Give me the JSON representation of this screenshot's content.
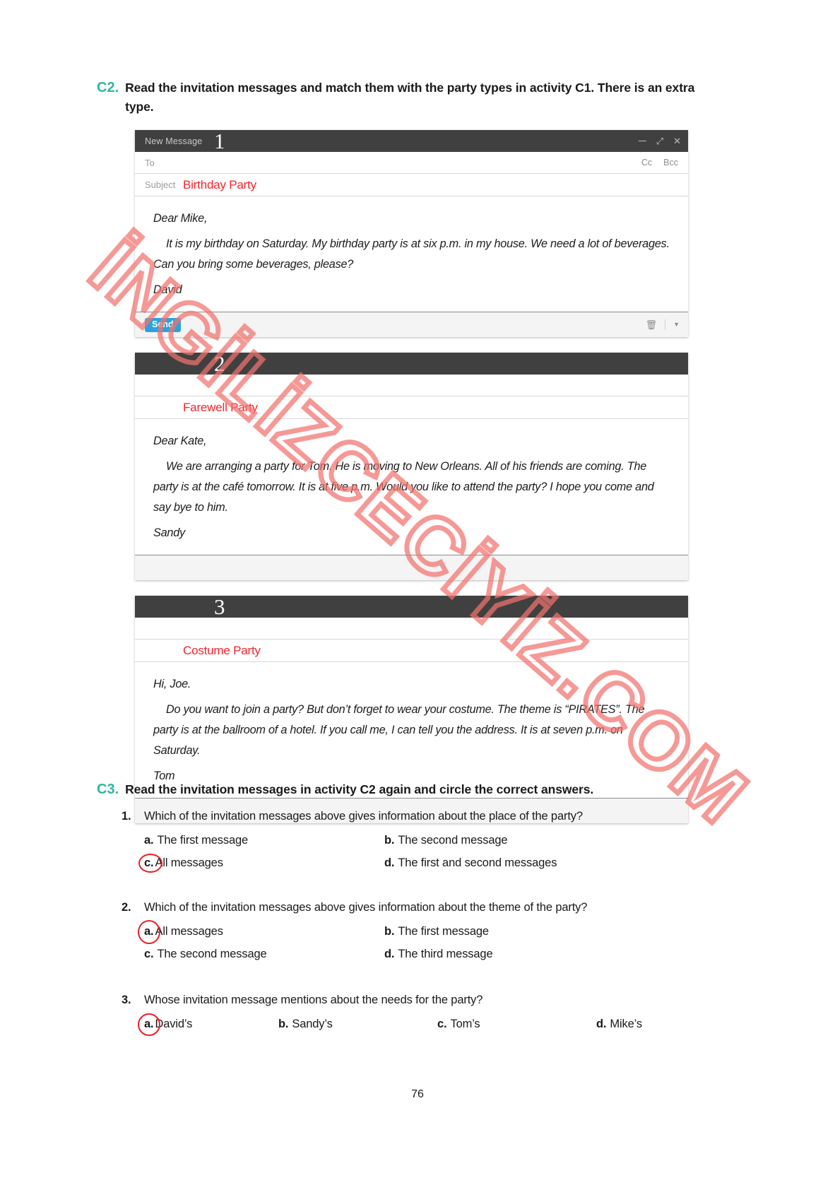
{
  "activities": {
    "c2": {
      "code": "C2.",
      "instruction": "Read the invitation messages and match them with the party types in activity C1. There is an extra type."
    },
    "c3": {
      "code": "C3.",
      "instruction": "Read the invitation messages in activity C2 again and circle the correct answers."
    }
  },
  "messages": [
    {
      "number": "1",
      "window_title": "New Message",
      "to_label": "To",
      "to_value": "",
      "cc_label": "Cc",
      "bcc_label": "Bcc",
      "subject_label": "Subject",
      "subject_value": "Birthday Party",
      "greeting": "Dear Mike,",
      "body": "It is my birthday on Saturday. My birthday party is at six p.m. in my house. We need a lot of beverages. Can you bring some beverages, please?",
      "signature": "David",
      "send_label": "Send",
      "trash_icon": "trash-icon",
      "caret_icon": "caret-down-icon"
    },
    {
      "number": "2",
      "window_title": "",
      "to_label": "",
      "to_value": "",
      "cc_label": "",
      "bcc_label": "",
      "subject_label": "",
      "subject_value": "Farewell Party",
      "greeting": "Dear Kate,",
      "body": "We are arranging a party for Tom. He is moving to New Orleans. All of his friends are coming. The party is at the café tomorrow. It is at five p.m. Would you like to attend the party? I hope you come and say bye to him.",
      "signature": "Sandy",
      "send_label": "",
      "trash_icon": "trash-icon",
      "caret_icon": "caret-down-icon"
    },
    {
      "number": "3",
      "window_title": "",
      "to_label": "",
      "to_value": "",
      "cc_label": "",
      "bcc_label": "",
      "subject_label": "",
      "subject_value": "Costume Party",
      "greeting": "Hi, Joe.",
      "body": "Do you want to join a party? But don’t forget to wear your costume. The theme is “PIRATES”. The party is at the ballroom of a hotel. If you call me, I can tell you the address. It is at seven p.m. on Saturday.",
      "signature": "Tom",
      "send_label": "",
      "trash_icon": "trash-icon",
      "caret_icon": "caret-down-icon"
    }
  ],
  "questions": [
    {
      "number": "1.",
      "text": "Which of the invitation messages above gives information about the place of the party?",
      "options": [
        {
          "letter": "a.",
          "text": "The first message",
          "circled": false
        },
        {
          "letter": "b.",
          "text": "The second message",
          "circled": false
        },
        {
          "letter": "c.",
          "text": "All messages",
          "circled": true
        },
        {
          "letter": "d.",
          "text": "The first and second messages",
          "circled": false
        }
      ]
    },
    {
      "number": "2.",
      "text": "Which of the invitation messages above gives information about the theme of the party?",
      "options": [
        {
          "letter": "a.",
          "text": "All messages",
          "circled": true
        },
        {
          "letter": "b.",
          "text": "The first message",
          "circled": false
        },
        {
          "letter": "c.",
          "text": "The second message",
          "circled": false
        },
        {
          "letter": "d.",
          "text": "The third message",
          "circled": false
        }
      ]
    },
    {
      "number": "3.",
      "text": "Whose invitation message mentions about the needs for the party?",
      "options": [
        {
          "letter": "a.",
          "text": "David’s",
          "circled": true
        },
        {
          "letter": "b.",
          "text": "Sandy’s",
          "circled": false
        },
        {
          "letter": "c.",
          "text": "Tom’s",
          "circled": false
        },
        {
          "letter": "d.",
          "text": "Mike’s",
          "circled": false
        }
      ]
    }
  ],
  "watermark": {
    "line1": "İNGİLİZCE",
    "line2": "CİXİZ.COM",
    "full": "INGILIZCECIYIZ.COM",
    "color": "#f2736e"
  },
  "page_number": "76",
  "colors": {
    "activity_code": "#2fb6a4",
    "subject_red": "#f5232a",
    "send_blue": "#2aa3dd",
    "titlebar": "#404040",
    "circle_red": "#ee1c25"
  }
}
